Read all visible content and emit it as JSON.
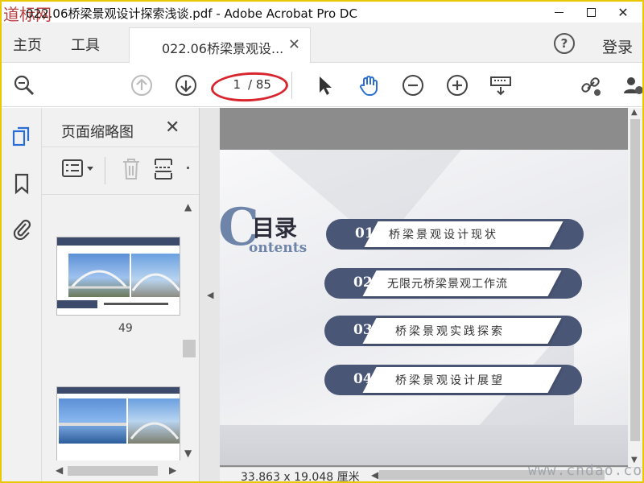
{
  "window": {
    "title": "022.06桥梁景观设计探索浅谈.pdf - Adobe Acrobat Pro DC",
    "watermark_corner": "道标网"
  },
  "menubar": {
    "home": "主页",
    "tools": "工具",
    "doc_tab": "022.06桥梁景观设...",
    "login": "登录"
  },
  "toolbar": {
    "page_current": "1",
    "page_total": "/ 85"
  },
  "thumbnail_panel": {
    "title": "页面缩略图",
    "page_label": "49"
  },
  "slide": {
    "big_letter": "C",
    "heading": "目录",
    "subheading": "ontents",
    "items": [
      {
        "num": "01",
        "text": "桥梁景观设计现状"
      },
      {
        "num": "02",
        "text": "无限元桥梁景观工作流"
      },
      {
        "num": "03",
        "text": "桥梁景观实践探索"
      },
      {
        "num": "04",
        "text": "桥梁景观设计展望"
      }
    ]
  },
  "statusbar": {
    "dimensions": "33.863 x 19.048 厘米"
  },
  "watermark": "www.cndao.com",
  "colors": {
    "accent_red": "#d8262e",
    "slide_pill": "#4a5676",
    "slide_blue": "#6e84a8",
    "toolbar_active": "#2a6ed4"
  }
}
